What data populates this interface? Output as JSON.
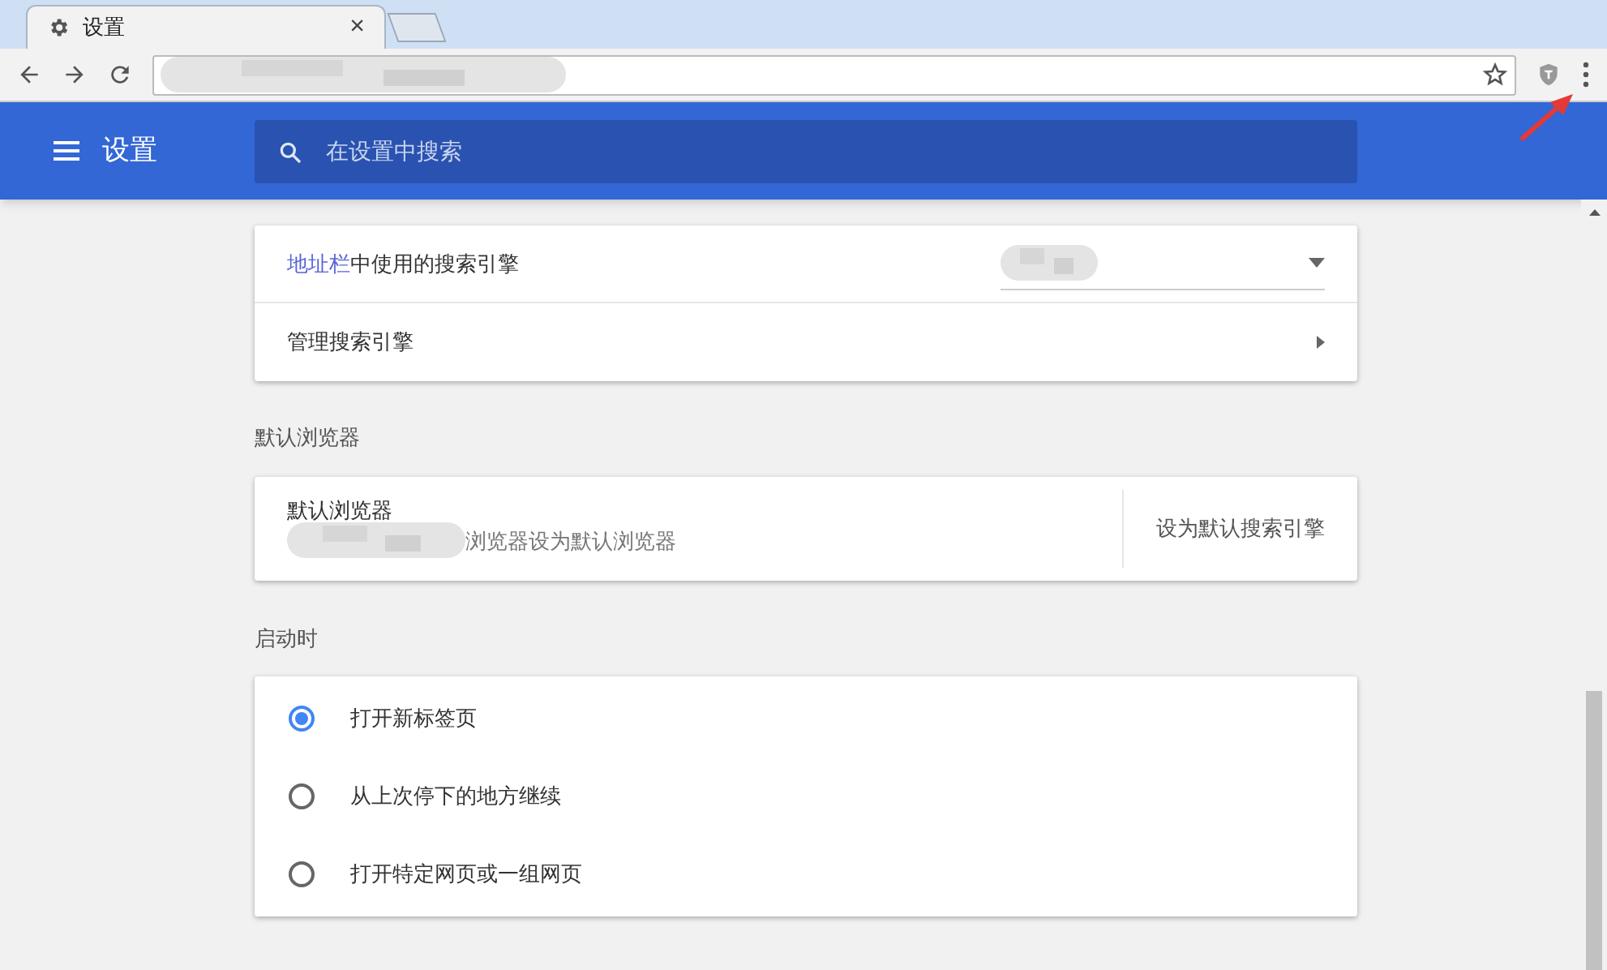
{
  "tab": {
    "title": "设置",
    "close": "×"
  },
  "header": {
    "title": "设置",
    "search_placeholder": "在设置中搜索"
  },
  "search_engine": {
    "label_link": "地址栏",
    "label_rest": "中使用的搜索引擎",
    "manage": "管理搜索引擎"
  },
  "default_browser": {
    "heading": "默认浏览器",
    "title": "默认浏览器",
    "description": "浏览器设为默认浏览器",
    "action": "设为默认搜索引擎"
  },
  "startup": {
    "heading": "启动时",
    "options": [
      {
        "label": "打开新标签页",
        "selected": true
      },
      {
        "label": "从上次停下的地方继续",
        "selected": false
      },
      {
        "label": "打开特定网页或一组网页",
        "selected": false
      }
    ]
  }
}
